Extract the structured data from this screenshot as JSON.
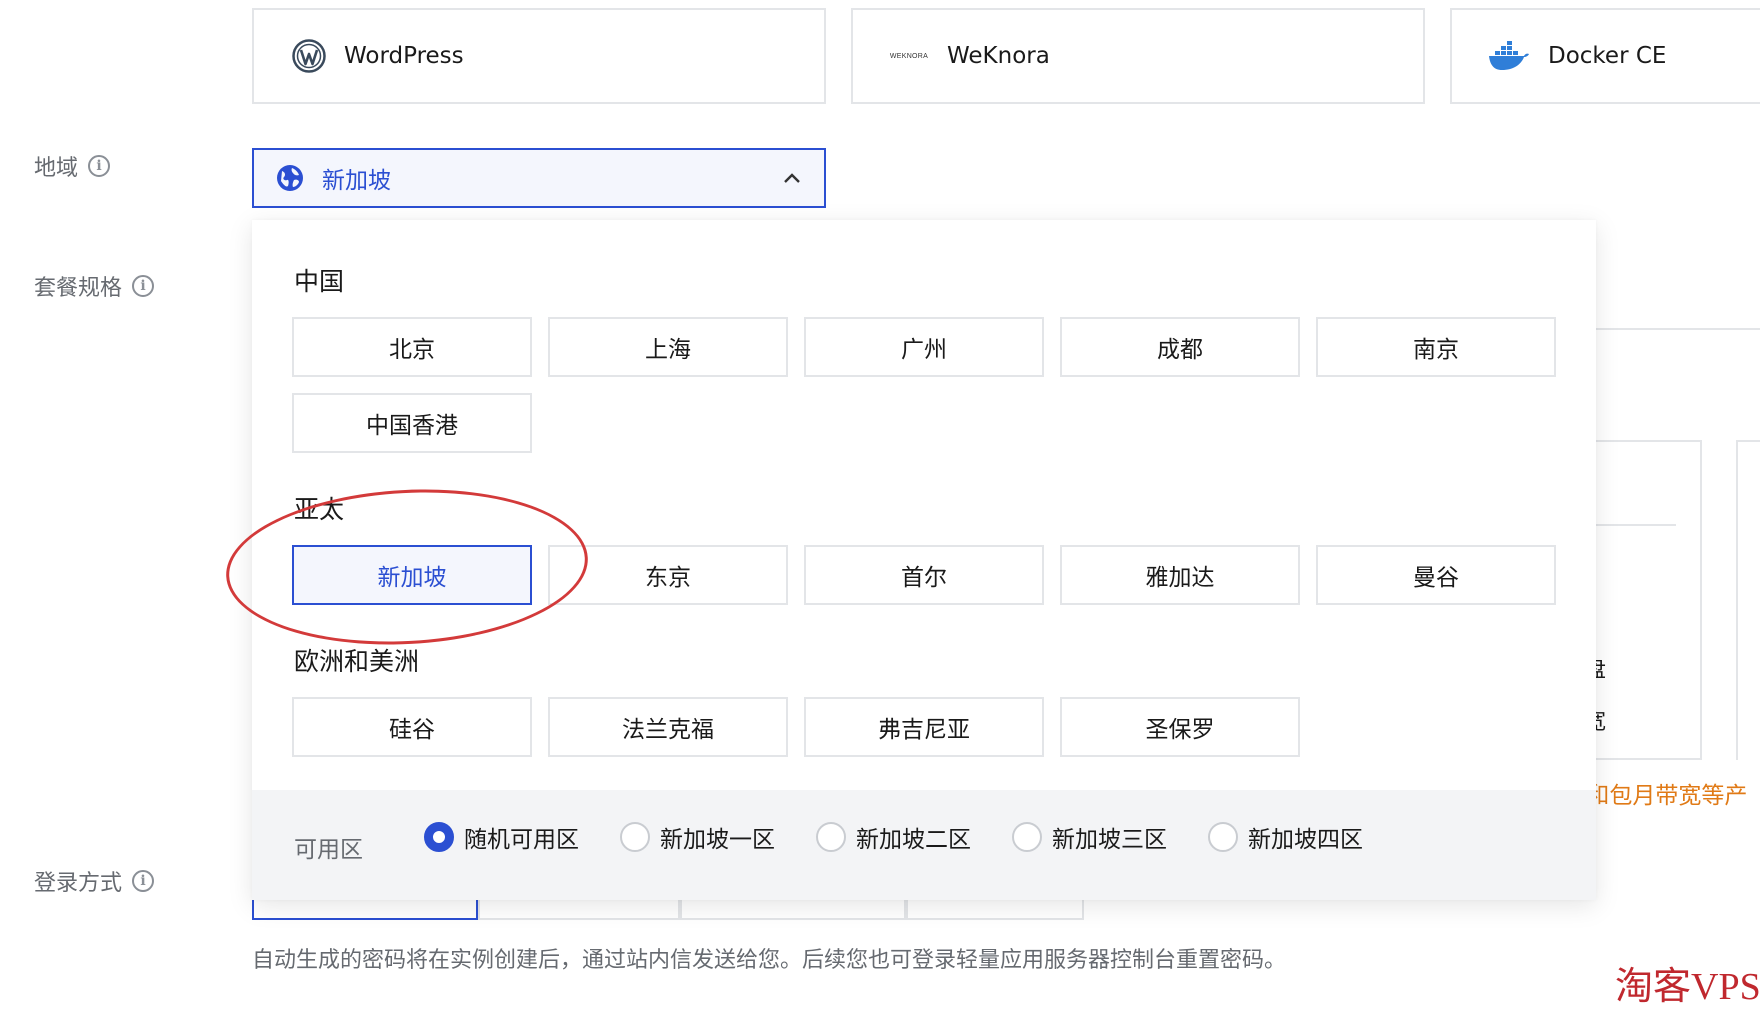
{
  "app_images": {
    "items": [
      {
        "id": "wp",
        "label": "WordPress",
        "icon": "wordpress-icon"
      },
      {
        "id": "wk",
        "label": "WeKnora",
        "icon": "weknora-logo",
        "logo_text": "WEKNORA"
      },
      {
        "id": "dk",
        "label": "Docker CE",
        "icon": "docker-icon"
      }
    ]
  },
  "form": {
    "region_label": "地域",
    "plan_label": "套餐规格",
    "login_label": "登录方式"
  },
  "region_select": {
    "value": "新加坡",
    "icon": "globe-icon",
    "expanded": true
  },
  "region_dropdown": {
    "groups": [
      {
        "title": "中国",
        "options": [
          "北京",
          "上海",
          "广州",
          "成都",
          "南京",
          "中国香港"
        ]
      },
      {
        "title": "亚太",
        "options": [
          "新加坡",
          "东京",
          "首尔",
          "雅加达",
          "曼谷"
        ]
      },
      {
        "title": "欧洲和美洲",
        "options": [
          "硅谷",
          "法兰克福",
          "弗吉尼亚",
          "圣保罗"
        ]
      }
    ],
    "selected": "新加坡",
    "zone": {
      "label": "可用区",
      "options": [
        "随机可用区",
        "新加坡一区",
        "新加坡二区",
        "新加坡三区",
        "新加坡四区"
      ],
      "selected": "随机可用区"
    }
  },
  "background_fragments": {
    "disk_fragment": "盘",
    "bandwidth_fragment": "宽",
    "orange_note_fragment": "l和包月带宽等产"
  },
  "login_hint": "自动生成的密码将在实例创建后，通过站内信发送给您。后续您也可登录轻量应用服务器控制台重置密码。",
  "watermark": "淘客VPS",
  "colors": {
    "accent": "#2b4fd2",
    "selected_bg": "#f4f6fd",
    "border": "#e3e5e8",
    "muted_text": "#666a70",
    "warning": "#e07a16",
    "annotation": "#d33a3a"
  }
}
